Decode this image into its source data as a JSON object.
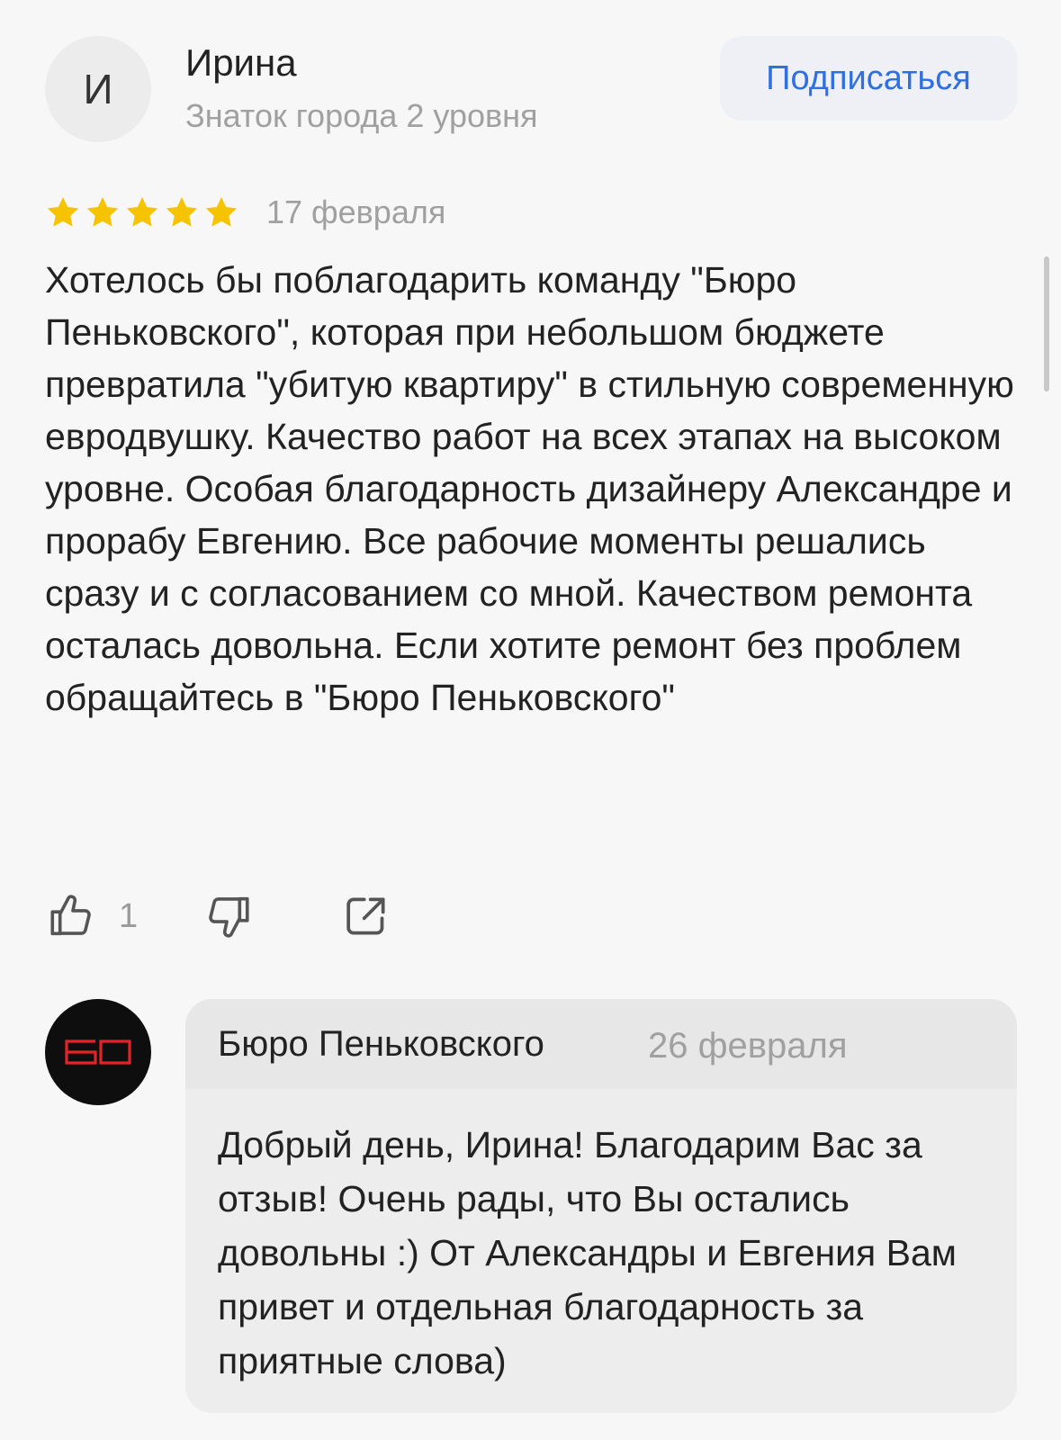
{
  "review": {
    "author": {
      "initial": "И",
      "name": "Ирина",
      "level": "Знаток города 2 уровня"
    },
    "subscribe_label": "Подписаться",
    "rating": 5,
    "max_rating": 5,
    "star_color": "#f6c300",
    "date": "17 февраля",
    "text": "Хотелось бы поблагодарить команду \"Бюро Пеньковского\", которая при небольшом бюджете превратила \"убитую квартиру\" в стильную современную евродвушку. Качество работ на всех этапах на высоком уровне. Особая благодарность дизайнеру Александре и прорабу Евгению. Все рабочие моменты решались сразу и с согласованием со мной. Качеством ремонта осталась довольна. Если хотите ремонт без проблем обращайтесь в \"Бюро Пеньковского\"",
    "actions": {
      "like_icon": "thumbs-up-icon",
      "like_count": "1",
      "dislike_icon": "thumbs-down-icon",
      "share_icon": "share-icon"
    }
  },
  "reply": {
    "company_logo": "БО",
    "logo_color": "#e0242a",
    "company_name": "Бюро Пеньковского",
    "date": "26 февраля",
    "text": "Добрый день, Ирина! Благодарим Вас за отзыв! Очень рады, что Вы остались довольны :) От Александры и Евгения Вам привет и отдельная благодарность за приятные слова)"
  },
  "colors": {
    "accent": "#2f6fe0",
    "background": "#f7f7f7"
  }
}
